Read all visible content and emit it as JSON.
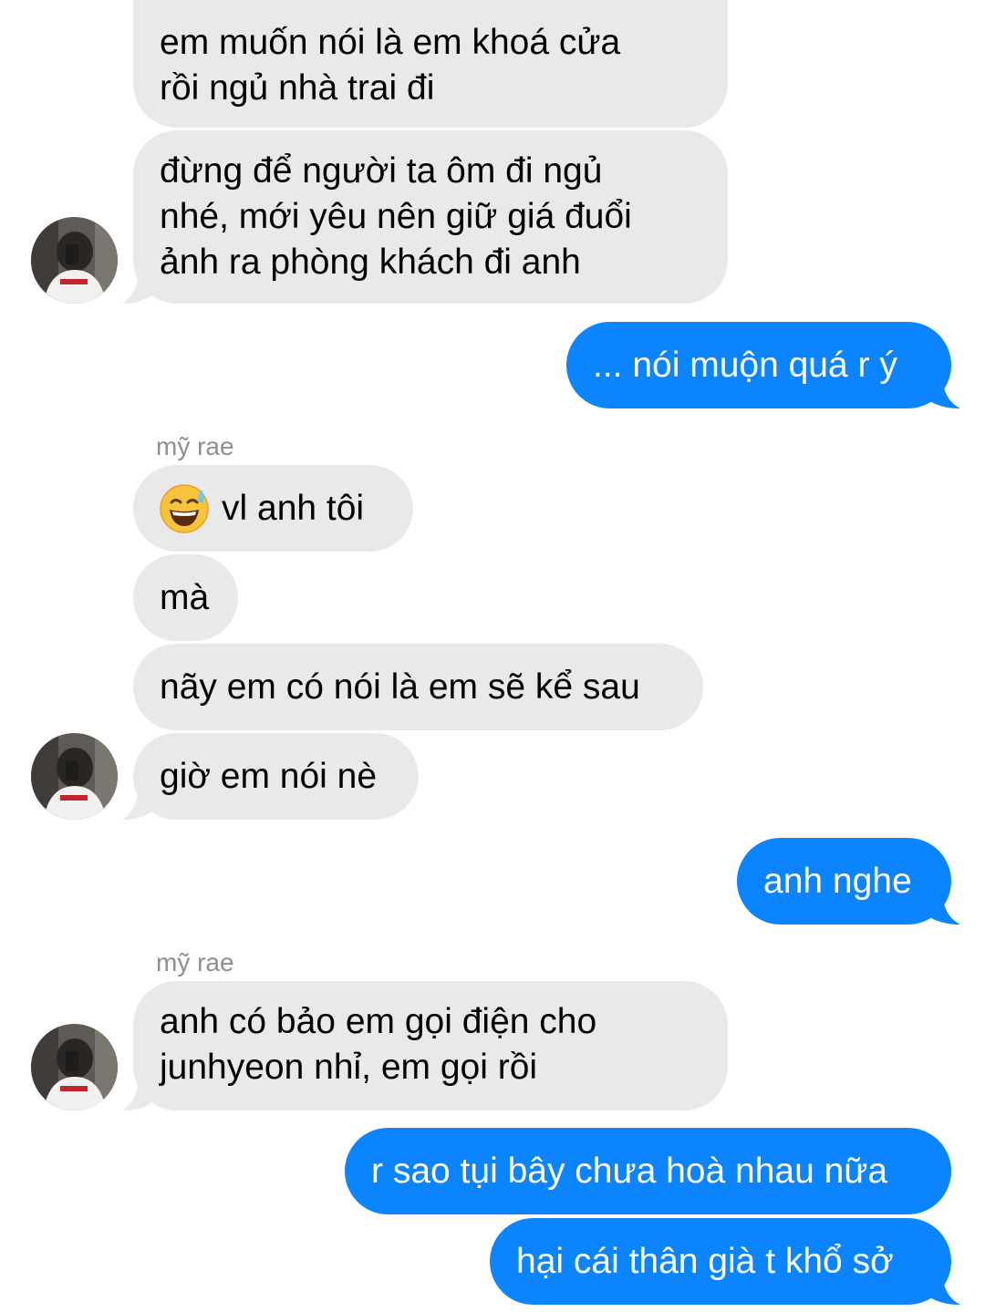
{
  "thread": {
    "sender_name": "mỹ rae",
    "messages": [
      {
        "from": "them",
        "lines": [
          "em muốn nói là em khoá cửa",
          "rồi ngủ nhà trai đi"
        ]
      },
      {
        "from": "them",
        "lines": [
          "đừng để người ta ôm đi ngủ",
          "nhé, mới yêu nên giữ giá đuổi",
          "ảnh ra phòng khách đi anh"
        ]
      },
      {
        "from": "me",
        "lines": [
          "... nói muộn quá r ý"
        ]
      },
      {
        "from": "them",
        "emoji": "sweat-smile-emoji",
        "lines": [
          "vl anh tôi"
        ]
      },
      {
        "from": "them",
        "lines": [
          "mà"
        ]
      },
      {
        "from": "them",
        "lines": [
          "nãy em có nói là em sẽ kể sau"
        ]
      },
      {
        "from": "them",
        "lines": [
          "giờ em nói nè"
        ]
      },
      {
        "from": "me",
        "lines": [
          "anh nghe"
        ]
      },
      {
        "from": "them",
        "lines": [
          "anh có bảo em gọi điện cho",
          "junhyeon nhỉ, em gọi rồi"
        ]
      },
      {
        "from": "me",
        "lines": [
          "r sao tụi bây chưa hoà nhau nữa"
        ]
      },
      {
        "from": "me",
        "lines": [
          "hại cái thân già t khổ sở"
        ]
      }
    ]
  },
  "colors": {
    "incoming_bubble": "#e9e9eb",
    "outgoing_bubble": "#0b84fe",
    "sender_label": "#8e8e93"
  }
}
